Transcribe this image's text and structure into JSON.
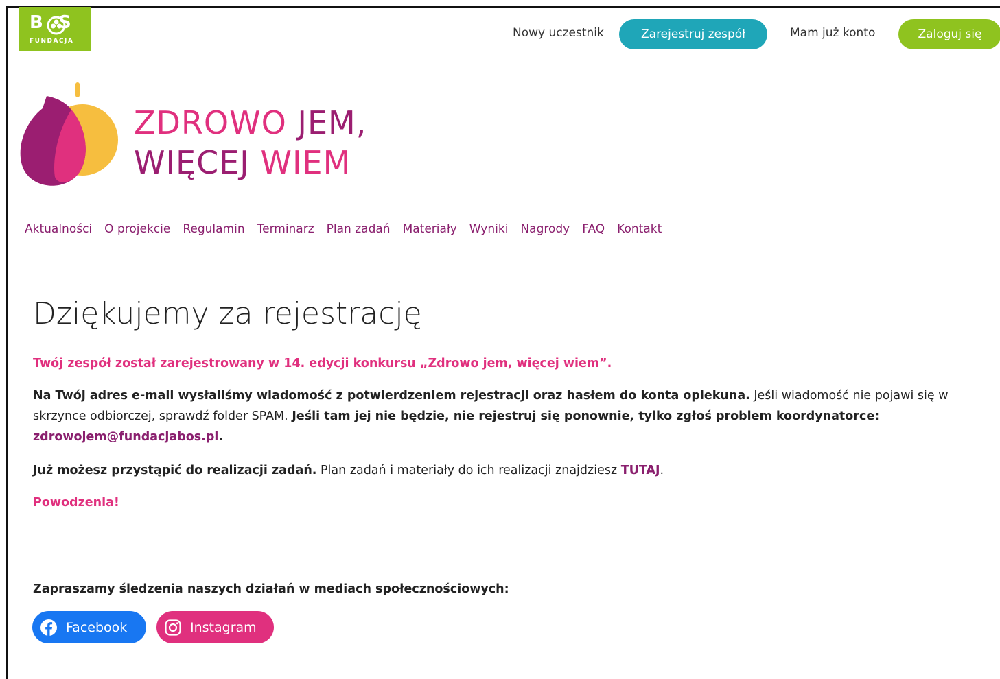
{
  "header": {
    "org_logo": {
      "word": "BOS",
      "sub": "FUNDACJA",
      "color": "#8fc31f"
    },
    "new_participant_text": "Nowy uczestnik",
    "register_button": "Zarejestruj zespół",
    "have_account_text": "Mam już konto",
    "login_button": "Zaloguj się"
  },
  "brand": {
    "title_line1_a": "ZDROWO",
    "title_line1_b": "JEM,",
    "title_line2_a": "WIĘCEJ",
    "title_line2_b": "WIEM"
  },
  "nav": {
    "items": [
      "Aktualności",
      "O projekcie",
      "Regulamin",
      "Terminarz",
      "Plan zadań",
      "Materiały",
      "Wyniki",
      "Nagrody",
      "FAQ",
      "Kontakt"
    ]
  },
  "main": {
    "title": "Dziękujemy za rejestrację",
    "p1": "Twój zespół został zarejestrowany w 14. edycji konkursu „Zdrowo jem, więcej wiem”.",
    "p2_bold1": "Na Twój adres e-mail wysłaliśmy wiadomość z potwierdzeniem rejestracji oraz hasłem do konta opiekuna.",
    "p2_text": " Jeśli wiadomość nie pojawi się w skrzynce odbiorczej, sprawdź folder SPAM. ",
    "p2_bold2": "Jeśli tam jej nie będzie, nie rejestruj się ponownie, tylko zgłoś problem koordynatorce:",
    "p2_email": "zdrowojem@fundacjabos.pl",
    "p2_end": ".",
    "p3_bold": "Już możesz przystąpić do realizacji zadań.",
    "p3_text": " Plan zadań i materiały do ich realizacji znajdziesz ",
    "p3_link": "TUTAJ",
    "p3_end": ".",
    "p4": "Powodzenia!",
    "social_intro": "Zapraszamy śledzenia naszych działań w mediach społecznościowych:"
  },
  "social": {
    "facebook": {
      "label": "Facebook",
      "icon": "facebook-icon",
      "color": "#1877f2"
    },
    "instagram": {
      "label": "Instagram",
      "icon": "instagram-icon",
      "color": "#e0307e"
    }
  },
  "colors": {
    "accent_pink": "#e0307e",
    "accent_purple": "#8a1f6e",
    "teal": "#1fa6b8",
    "green": "#8fc31f"
  }
}
